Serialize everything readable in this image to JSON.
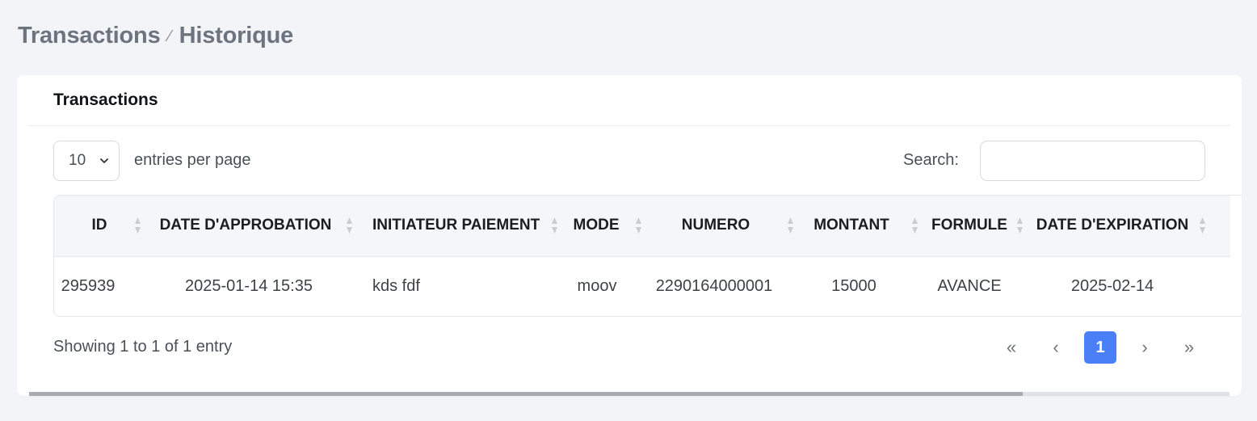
{
  "breadcrumb": {
    "parent": "Transactions",
    "separator": "⁄",
    "current": "Historique"
  },
  "card": {
    "title": "Transactions"
  },
  "controls": {
    "page_length_value": "10",
    "page_length_label": "entries per page",
    "search_label": "Search:",
    "search_value": ""
  },
  "table": {
    "columns": [
      "ID",
      "DATE D'APPROBATION",
      "INITIATEUR PAIEMENT",
      "MODE",
      "NUMERO",
      "MONTANT",
      "FORMULE",
      "DATE D'EXPIRATION"
    ],
    "rows": [
      {
        "id": "295939",
        "date_approbation": "2025-01-14 15:35",
        "initiateur": "kds fdf",
        "mode": "moov",
        "numero": "2290164000001",
        "montant": "15000",
        "formule": "AVANCE",
        "date_expiration": "2025-02-14"
      }
    ]
  },
  "footer": {
    "info": "Showing 1 to 1 of 1 entry",
    "pagination": {
      "first": "«",
      "prev": "‹",
      "current": "1",
      "next": "›",
      "last": "»"
    }
  },
  "colors": {
    "accent": "#4a7ff8",
    "background": "#f3f4f8",
    "header_bg": "#f4f6f9"
  }
}
